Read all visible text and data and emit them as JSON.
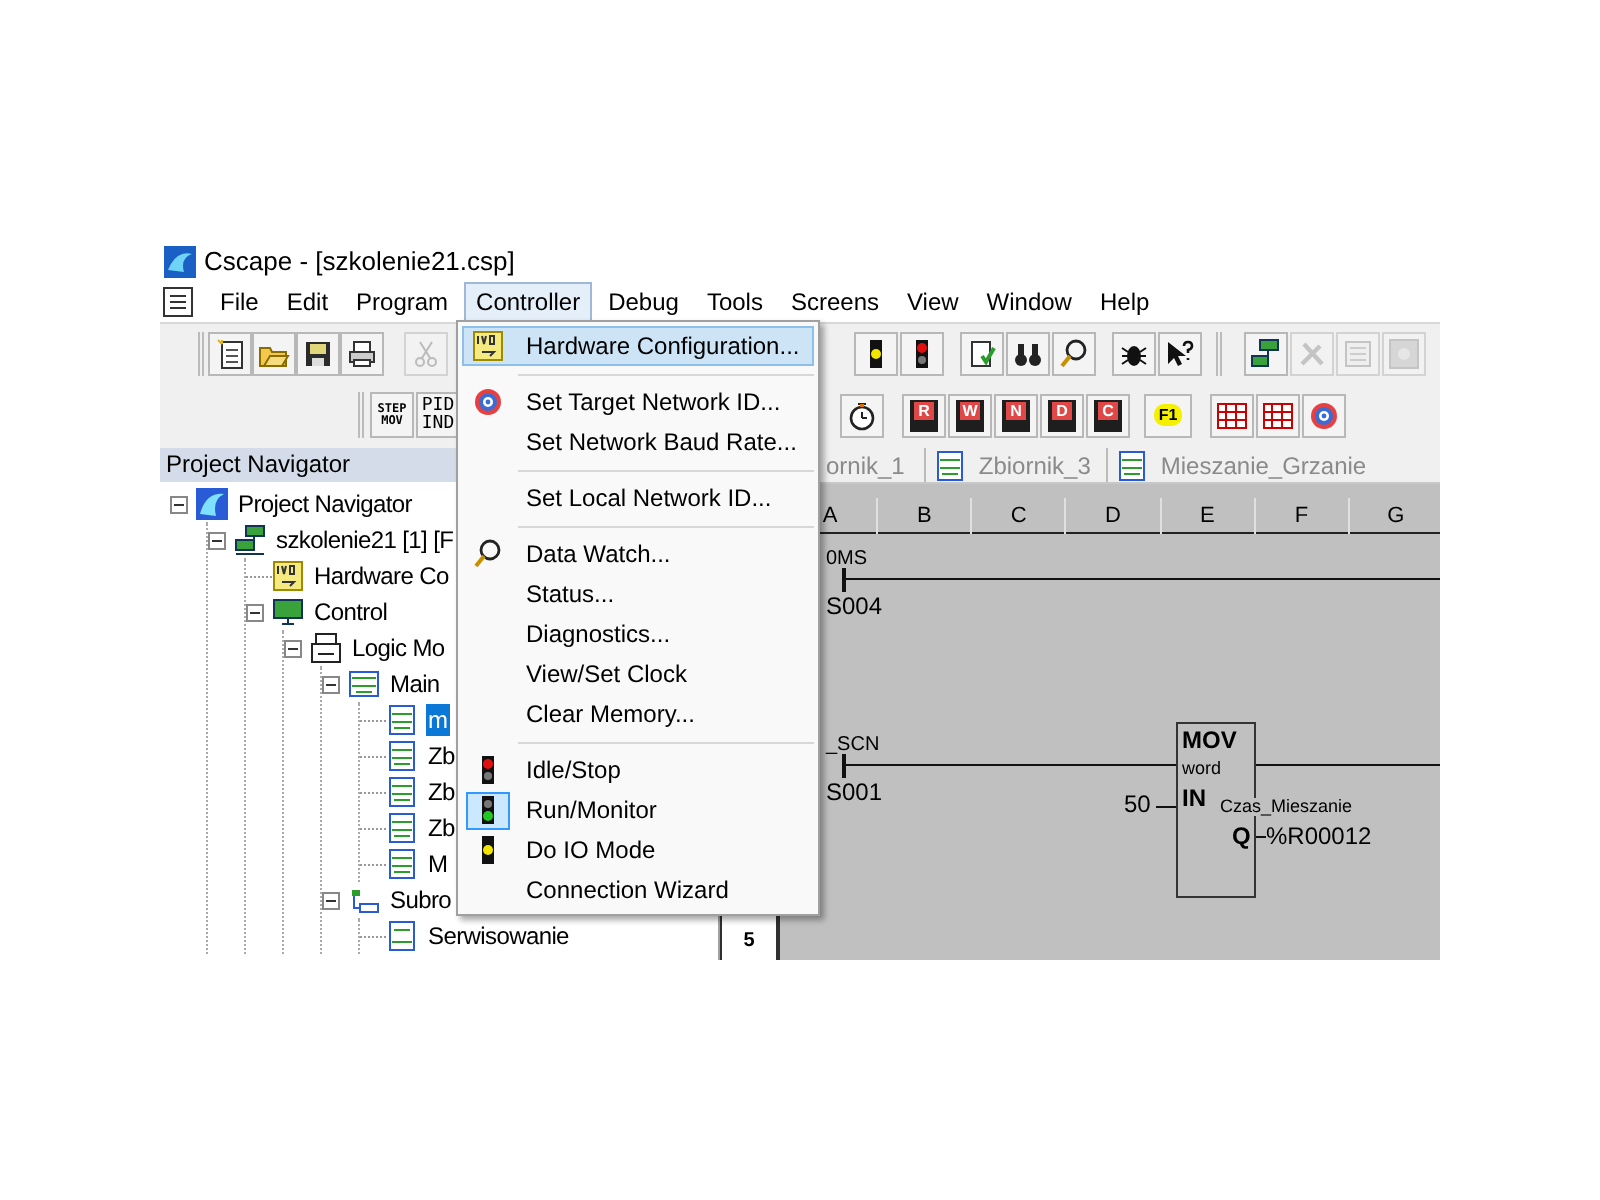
{
  "window": {
    "title": "Cscape - [szkolenie21.csp]"
  },
  "menus": [
    {
      "label": "File",
      "selected": false
    },
    {
      "label": "Edit",
      "selected": false
    },
    {
      "label": "Program",
      "selected": false
    },
    {
      "label": "Controller",
      "selected": true
    },
    {
      "label": "Debug",
      "selected": false
    },
    {
      "label": "Tools",
      "selected": false
    },
    {
      "label": "Screens",
      "selected": false
    },
    {
      "label": "View",
      "selected": false
    },
    {
      "label": "Window",
      "selected": false
    },
    {
      "label": "Help",
      "selected": false
    }
  ],
  "toolbar_1": [
    {
      "disabled": false
    },
    {
      "disabled": false
    },
    {
      "disabled": false
    },
    {
      "disabled": false
    },
    {
      "disabled": true
    },
    {
      "disabled": false
    },
    {
      "disabled": false
    },
    {
      "disabled": false
    },
    {
      "disabled": false
    },
    {
      "disabled": false
    },
    {
      "disabled": false
    },
    {
      "disabled": false
    },
    {
      "disabled": false
    },
    {
      "disabled": true
    },
    {
      "disabled": true
    },
    {
      "disabled": true
    }
  ],
  "toolbar_2": {
    "text_buttons": [
      {
        "top": "STEP",
        "bottom": "MOV"
      },
      {
        "top": "PID",
        "bottom": "IND"
      }
    ],
    "memory_buttons": [
      "R",
      "W",
      "N",
      "D",
      "C"
    ],
    "help_button": "F1"
  },
  "open_menu": {
    "items": [
      {
        "kind": "item",
        "label": "Hardware Configuration...",
        "selected": true,
        "checked": false
      },
      {
        "kind": "separator"
      },
      {
        "kind": "item",
        "label": "Set Target Network ID...",
        "selected": false,
        "checked": false
      },
      {
        "kind": "item",
        "label": "Set Network Baud Rate...",
        "selected": false,
        "checked": false
      },
      {
        "kind": "separator"
      },
      {
        "kind": "item",
        "label": "Set Local Network ID...",
        "selected": false,
        "checked": false
      },
      {
        "kind": "separator"
      },
      {
        "kind": "item",
        "label": "Data Watch...",
        "selected": false,
        "checked": false
      },
      {
        "kind": "item",
        "label": "Status...",
        "selected": false,
        "checked": false
      },
      {
        "kind": "item",
        "label": "Diagnostics...",
        "selected": false,
        "checked": false
      },
      {
        "kind": "item",
        "label": "View/Set Clock",
        "selected": false,
        "checked": false
      },
      {
        "kind": "item",
        "label": "Clear Memory...",
        "selected": false,
        "checked": false
      },
      {
        "kind": "separator"
      },
      {
        "kind": "item",
        "label": "Idle/Stop",
        "selected": false,
        "checked": false
      },
      {
        "kind": "item",
        "label": "Run/Monitor",
        "selected": false,
        "checked": true
      },
      {
        "kind": "item",
        "label": "Do IO Mode",
        "selected": false,
        "checked": false
      },
      {
        "kind": "item",
        "label": "Connection Wizard",
        "selected": false,
        "checked": false
      }
    ]
  },
  "navigator": {
    "title": "Project Navigator",
    "tree": [
      {
        "kind": "project",
        "label": "Project Navigator",
        "selected": false,
        "expanded": true,
        "children": [
          {
            "kind": "device",
            "label": "szkolenie21 [1] [F",
            "selected": false,
            "expanded": true,
            "children": [
              {
                "kind": "hardware",
                "label": "Hardware Co",
                "selected": false
              },
              {
                "kind": "controller",
                "label": "Control",
                "selected": false,
                "expanded": true,
                "children": [
                  {
                    "kind": "module",
                    "label": "Logic Mo",
                    "selected": false,
                    "expanded": true,
                    "children": [
                      {
                        "kind": "folder",
                        "label": "Main",
                        "selected": false,
                        "expanded": true,
                        "children": [
                          {
                            "kind": "program",
                            "label": "m",
                            "selected": true
                          },
                          {
                            "kind": "program",
                            "label": "Zb",
                            "selected": false
                          },
                          {
                            "kind": "program",
                            "label": "Zb",
                            "selected": false
                          },
                          {
                            "kind": "program",
                            "label": "Zb",
                            "selected": false
                          },
                          {
                            "kind": "program",
                            "label": "M",
                            "selected": false
                          }
                        ]
                      },
                      {
                        "kind": "subroutines",
                        "label": "Subro",
                        "selected": false,
                        "expanded": true,
                        "children": [
                          {
                            "kind": "subroutine",
                            "label": "Serwisowanie",
                            "selected": false
                          }
                        ]
                      }
                    ]
                  }
                ]
              }
            ]
          }
        ]
      }
    ]
  },
  "editor_tabs": [
    {
      "label": "ornik_1",
      "selected": false
    },
    {
      "label": "Zbiornik_3",
      "selected": false
    },
    {
      "label": "Mieszanie_Grzanie",
      "selected": false
    }
  ],
  "ladder": {
    "column_headers": [
      "A",
      "B",
      "C",
      "D",
      "E",
      "F",
      "G"
    ],
    "line_numbers": [
      "5"
    ],
    "rungs": [
      {
        "top_label": "0MS",
        "bottom_label": "S004"
      },
      {
        "top_label": "_SCN",
        "bottom_label": "S001",
        "block": {
          "title": "MOV",
          "type": "word",
          "input_value": "50",
          "input_label": "IN",
          "output_label": "Q",
          "output_name": "Czas_Mieszanie",
          "output_address": "%R00012"
        }
      }
    ]
  }
}
